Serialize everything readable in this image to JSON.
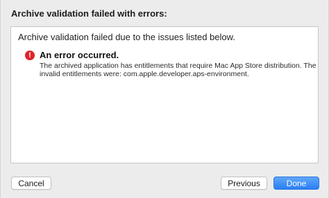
{
  "dialog": {
    "header_title": "Archive validation failed with errors:",
    "summary": "Archive validation failed due to the issues listed below.",
    "issues": [
      {
        "icon": "error-icon",
        "icon_glyph": "!",
        "icon_color": "#e0242a",
        "title": "An error occurred.",
        "description": "The archived application has entitlements that require Mac App Store distribution.  The invalid entitlements were: com.apple.developer.aps-environment."
      }
    ]
  },
  "buttons": {
    "cancel": "Cancel",
    "previous": "Previous",
    "done": "Done"
  },
  "colors": {
    "accent": "#2a7ff3",
    "error": "#e0242a"
  }
}
